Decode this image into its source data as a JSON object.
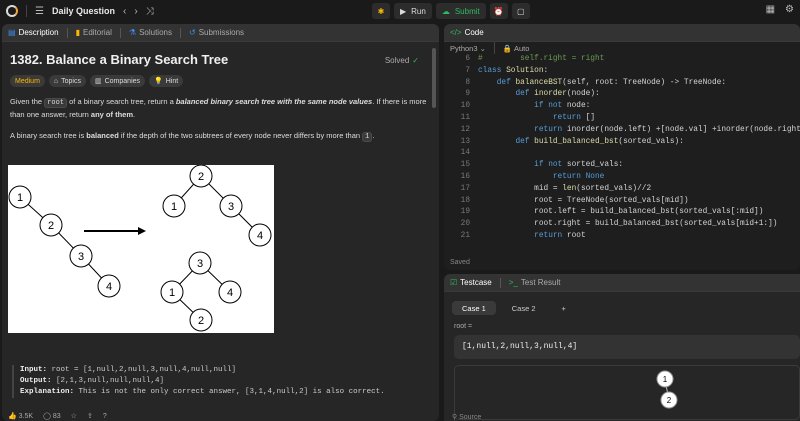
{
  "topbar": {
    "title": "Daily Question",
    "run_label": "Run",
    "submit_label": "Submit"
  },
  "left_tabs": [
    "Description",
    "Editorial",
    "Solutions",
    "Submissions"
  ],
  "problem": {
    "title": "1382. Balance a Binary Search Tree",
    "status": "Solved",
    "difficulty": "Medium",
    "chips": [
      "Topics",
      "Companies",
      "Hint"
    ],
    "p1_a": "Given the",
    "p1_code": "root",
    "p1_b": "of a binary search tree, return a",
    "p1_bold": "balanced",
    "p1_c": "binary search tree with the same node values",
    "p1_d": ". If there is more than one answer, return",
    "p1_bold2": "any of them",
    "p1_e": ".",
    "p2_a": "A binary search tree is",
    "p2_bold": "balanced",
    "p2_b": "if the depth of the two subtrees of every node never differs by more than",
    "p2_code": "1",
    "p2_c": ".",
    "example_title": "Example 1:",
    "input_label": "Input:",
    "input_value": "root = [1,null,2,null,3,null,4,null,null]",
    "output_label": "Output:",
    "output_value": "[2,1,3,null,null,null,4]",
    "expl_label": "Explanation:",
    "expl_value": "This is not the only correct answer, [3,1,4,null,2] is also correct.",
    "likes": "3.5K",
    "comments": "83"
  },
  "figure_nodes": [
    "1",
    "2",
    "3",
    "4",
    "2",
    "1",
    "3",
    "4",
    "3",
    "1",
    "4",
    "2"
  ],
  "code_panel": {
    "tab_label": "Code",
    "language": "Python3",
    "auto_label": "Auto",
    "saved_label": "Saved",
    "lines": [
      {
        "n": "6",
        "segs": [
          [
            "cm",
            "#        self.right = right"
          ]
        ]
      },
      {
        "n": "7",
        "segs": [
          [
            "kw",
            "class "
          ],
          [
            "fn",
            "Solution"
          ],
          [
            "tx",
            ":"
          ]
        ]
      },
      {
        "n": "8",
        "segs": [
          [
            "tx",
            "    "
          ],
          [
            "kw",
            "def "
          ],
          [
            "fn",
            "balanceBST"
          ],
          [
            "tx",
            "(self, root: TreeNode) -> TreeNode:"
          ]
        ]
      },
      {
        "n": "9",
        "segs": [
          [
            "tx",
            "        "
          ],
          [
            "kw",
            "def "
          ],
          [
            "fn",
            "inorder"
          ],
          [
            "tx",
            "(node):"
          ]
        ]
      },
      {
        "n": "10",
        "segs": [
          [
            "tx",
            "            "
          ],
          [
            "kw",
            "if not "
          ],
          [
            "tx",
            "node:"
          ]
        ]
      },
      {
        "n": "11",
        "segs": [
          [
            "tx",
            "                "
          ],
          [
            "kw",
            "return "
          ],
          [
            "tx",
            "[]"
          ]
        ]
      },
      {
        "n": "12",
        "segs": [
          [
            "tx",
            "            "
          ],
          [
            "kw",
            "return "
          ],
          [
            "tx",
            "inorder(node.left) +[node.val] +inorder(node.right"
          ]
        ]
      },
      {
        "n": "13",
        "segs": [
          [
            "tx",
            "        "
          ],
          [
            "kw",
            "def "
          ],
          [
            "fn",
            "build_balanced_bst"
          ],
          [
            "tx",
            "(sorted_vals):"
          ]
        ]
      },
      {
        "n": "14",
        "segs": [
          [
            "tx",
            ""
          ]
        ]
      },
      {
        "n": "15",
        "segs": [
          [
            "tx",
            "            "
          ],
          [
            "kw",
            "if not "
          ],
          [
            "tx",
            "sorted_vals:"
          ]
        ]
      },
      {
        "n": "16",
        "segs": [
          [
            "tx",
            "                "
          ],
          [
            "kw",
            "return None"
          ]
        ]
      },
      {
        "n": "17",
        "segs": [
          [
            "tx",
            "            mid = "
          ],
          [
            "fn",
            "len"
          ],
          [
            "tx",
            "(sorted_vals)//2"
          ]
        ]
      },
      {
        "n": "18",
        "segs": [
          [
            "tx",
            "            root = TreeNode(sorted_vals[mid])"
          ]
        ]
      },
      {
        "n": "19",
        "segs": [
          [
            "tx",
            "            root.left = build_balanced_bst(sorted_vals[:mid])"
          ]
        ]
      },
      {
        "n": "20",
        "segs": [
          [
            "tx",
            "            root.right = build_balanced_bst(sorted_vals[mid+1:])"
          ]
        ]
      },
      {
        "n": "21",
        "segs": [
          [
            "tx",
            "            "
          ],
          [
            "kw",
            "return "
          ],
          [
            "tx",
            "root"
          ]
        ]
      }
    ]
  },
  "test_panel": {
    "tabs": [
      "Testcase",
      "Test Result"
    ],
    "cases": [
      "Case 1",
      "Case 2"
    ],
    "add_label": "+",
    "root_label": "root =",
    "input_value": "[1,null,2,null,3,null,4]",
    "viz_nodes": [
      "1",
      "2"
    ],
    "source_label": "Source"
  }
}
